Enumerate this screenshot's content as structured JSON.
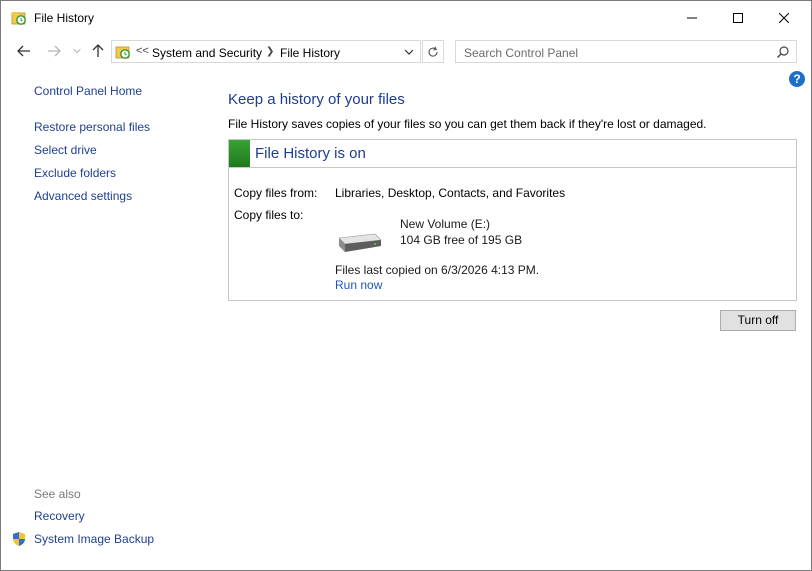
{
  "window": {
    "title": "File History",
    "icon": "file-history-icon"
  },
  "nav": {
    "breadcrumb_overflow": "<<",
    "breadcrumb": [
      "System and Security",
      "File History"
    ],
    "search_placeholder": "Search Control Panel"
  },
  "sidebar": {
    "home": "Control Panel Home",
    "items": [
      {
        "label": "Restore personal files"
      },
      {
        "label": "Select drive"
      },
      {
        "label": "Exclude folders"
      },
      {
        "label": "Advanced settings"
      }
    ],
    "see_also_heading": "See also",
    "see_also": [
      {
        "label": "Recovery"
      },
      {
        "label": "System Image Backup",
        "icon": "uac-shield-icon"
      }
    ]
  },
  "main": {
    "title": "Keep a history of your files",
    "description": "File History saves copies of your files so you can get them back if they're lost or damaged.",
    "status": {
      "title": "File History is on",
      "color": "#2e9a2a"
    },
    "copy_from_label": "Copy files from:",
    "copy_from_value": "Libraries, Desktop, Contacts, and Favorites",
    "copy_to_label": "Copy files to:",
    "drive_name": "New Volume (E:)",
    "drive_free": "104 GB free of 195 GB",
    "last_copied": "Files last copied on 6/3/2026 4:13 PM.",
    "run_now": "Run now",
    "turn_off": "Turn off"
  },
  "help_label": "?"
}
